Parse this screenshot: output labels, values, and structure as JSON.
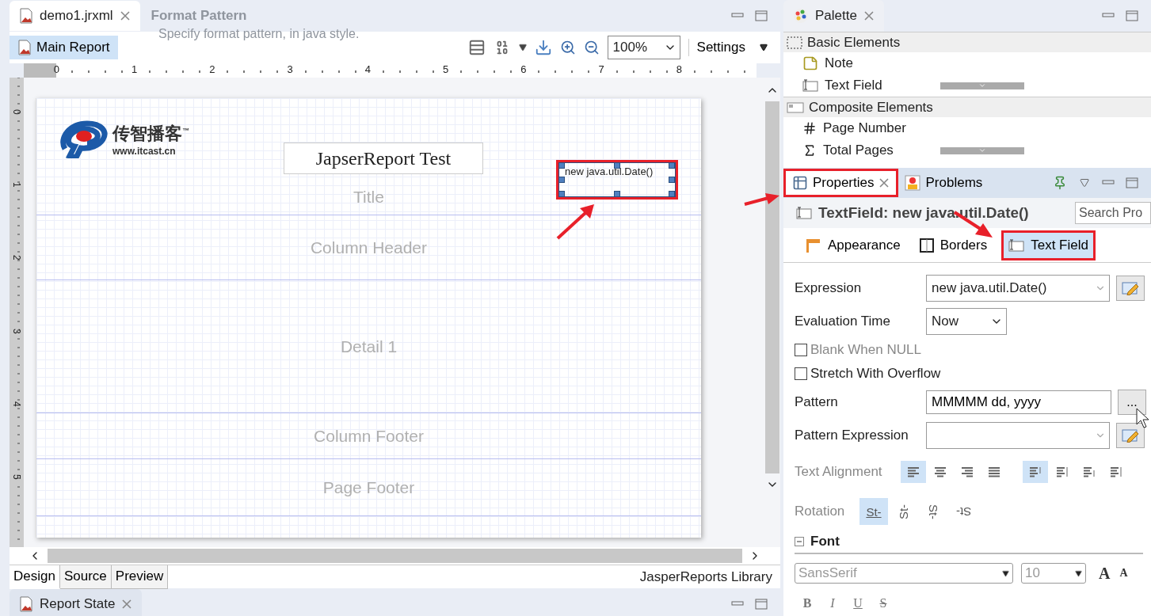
{
  "editor": {
    "tab": {
      "label": "demo1.jrxml",
      "selected": true
    },
    "overlay_dialog": {
      "title": "Format Pattern",
      "subtitle": "Specify format pattern, in java style."
    },
    "report_button": {
      "label": "Main Report",
      "selected": true
    },
    "zoom": "100%",
    "settings": "Settings",
    "ruler": [
      "0",
      "1",
      "2",
      "3",
      "4",
      "5",
      "6",
      "7",
      "8"
    ],
    "vertical_ruler": [
      "0",
      "1",
      "2",
      "3",
      "4",
      "5"
    ],
    "report": {
      "logo": {
        "name": "传智播客",
        "tm": "™",
        "url": "www.itcast.cn"
      },
      "title_text": "JapserReport Test",
      "date_field": {
        "text": "new java.util.Date()",
        "selected": true,
        "highlighted": true
      },
      "bands": [
        {
          "label": "Title",
          "kind": "title"
        },
        {
          "label": "Column Header",
          "kind": "plain"
        },
        {
          "label": "Detail 1",
          "kind": "plain"
        },
        {
          "label": "Column Footer",
          "kind": "plain"
        },
        {
          "label": "Page Footer",
          "kind": "plain"
        }
      ]
    },
    "view_tabs": [
      {
        "label": "Design",
        "selected": true
      },
      {
        "label": "Source",
        "selected": false
      },
      {
        "label": "Preview",
        "selected": false
      }
    ],
    "library": "JasperReports Library"
  },
  "bottom_panel": {
    "tab": "Report State"
  },
  "palette": {
    "tab": "Palette",
    "sections": [
      {
        "label": "Basic Elements",
        "kind": "basic",
        "items": [
          {
            "label": "Note",
            "kind": "note"
          },
          {
            "label": "Text Field",
            "kind": "textfield"
          }
        ]
      },
      {
        "label": "Composite Elements",
        "kind": "composite",
        "items": [
          {
            "label": "Page Number",
            "kind": "number"
          },
          {
            "label": "Total Pages",
            "kind": "sum"
          }
        ]
      }
    ]
  },
  "properties": {
    "tabs": [
      {
        "label": "Properties",
        "selected": true,
        "highlighted": true,
        "kind": "properties"
      },
      {
        "label": "Problems",
        "selected": false,
        "highlighted": false,
        "kind": "problems"
      }
    ],
    "title": "TextField: new java.util.Date()",
    "search": {
      "placeholder": "Search Pro"
    },
    "sections": [
      {
        "label": "Appearance",
        "kind": "appearance",
        "selected": false,
        "highlighted": false
      },
      {
        "label": "Borders",
        "kind": "borders",
        "selected": false,
        "highlighted": false
      },
      {
        "label": "Text Field",
        "kind": "textfield",
        "selected": true,
        "highlighted": true
      }
    ],
    "expression": {
      "label": "Expression",
      "value": "new java.util.Date()"
    },
    "evaluation_time": {
      "label": "Evaluation Time",
      "value": "Now"
    },
    "checkboxes": [
      {
        "label": "Blank When NULL",
        "checked": false,
        "disabled": true
      },
      {
        "label": "Stretch With Overflow",
        "checked": false,
        "disabled": false
      }
    ],
    "pattern": {
      "label": "Pattern",
      "value": "MMMMM dd, yyyy",
      "button": "..."
    },
    "pattern_expression": {
      "label": "Pattern Expression"
    },
    "text_alignment": {
      "label": "Text Alignment",
      "horizontal": [
        {
          "kind": "left",
          "selected": true
        },
        {
          "kind": "center",
          "selected": false
        },
        {
          "kind": "right",
          "selected": false
        },
        {
          "kind": "justify",
          "selected": false
        }
      ],
      "vertical": [
        {
          "kind": "top",
          "selected": true
        },
        {
          "kind": "middle",
          "selected": false
        },
        {
          "kind": "bottom",
          "selected": false
        },
        {
          "kind": "justify",
          "selected": false
        }
      ]
    },
    "rotation": {
      "label": "Rotation",
      "options": [
        {
          "label": "St-",
          "kind": "none",
          "selected": true
        },
        {
          "label": "St-",
          "kind": "left",
          "selected": false
        },
        {
          "label": "St-",
          "kind": "right",
          "selected": false
        },
        {
          "label": "St-",
          "kind": "upside",
          "selected": false
        }
      ]
    },
    "font": {
      "label": "Font",
      "expanded": true,
      "family": "SansSerif",
      "size": "10",
      "size_buttons": [
        {
          "label": "A",
          "kind": "increase"
        },
        {
          "label": "A",
          "kind": "decrease"
        }
      ],
      "styles": [
        {
          "label": "B",
          "kind": "bold"
        },
        {
          "label": "I",
          "kind": "italic"
        },
        {
          "label": "U",
          "kind": "underline"
        },
        {
          "label": "S",
          "kind": "strike"
        }
      ]
    }
  }
}
